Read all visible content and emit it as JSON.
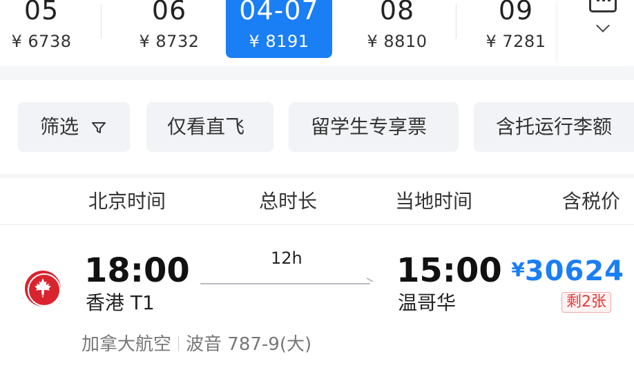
{
  "date_strip": {
    "dates": [
      {
        "date": "05",
        "price": "¥ 6738"
      },
      {
        "date": "06",
        "price": "¥ 8732"
      },
      {
        "date": "04-07",
        "price": "¥ 8191",
        "selected": true
      },
      {
        "date": "08",
        "price": "¥ 8810"
      },
      {
        "date": "09",
        "price": "¥ 7281"
      }
    ],
    "calendar_icon": "calendar-icon",
    "expand_icon": "chevron-down-icon"
  },
  "filters": {
    "items": [
      {
        "label": "筛选",
        "icon": "funnel-icon"
      },
      {
        "label": "仅看直飞"
      },
      {
        "label": "留学生专享票"
      },
      {
        "label": "含托运行李额"
      }
    ]
  },
  "columns": {
    "departure_time": "北京时间",
    "duration": "总时长",
    "arrival_time": "当地时间",
    "price": "含税价"
  },
  "flight": {
    "airline_icon": "air-canada-maple-leaf-icon",
    "depart_time": "18:00",
    "depart_place": "香港 T1",
    "duration": "12h",
    "arrive_time": "15:00",
    "arrive_place": "温哥华",
    "currency": "¥",
    "price": "30624",
    "remaining": "剩2张",
    "airline": "加拿大航空",
    "aircraft": "波音 787-9(大)"
  },
  "colors": {
    "accent": "#1a7ef5",
    "alert": "#e53935",
    "airline_red": "#d9232e",
    "page_bg": "#f5f6f8"
  }
}
